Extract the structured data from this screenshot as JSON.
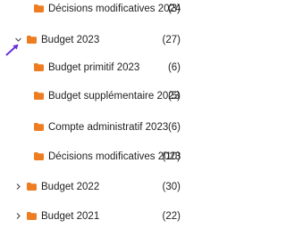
{
  "tree": {
    "items": [
      {
        "label": "Décisions modificatives 2024",
        "count": "(3)",
        "level": 1,
        "expander": "none",
        "folder_icon": "folder-icon"
      },
      {
        "label": "Budget 2023",
        "count": "(27)",
        "level": 0,
        "expander": "expanded",
        "folder_icon": "folder-icon"
      },
      {
        "label": "Budget primitif 2023",
        "count": "(6)",
        "level": 1,
        "expander": "none",
        "folder_icon": "folder-icon"
      },
      {
        "label": "Budget supplémentaire 2023",
        "count": "(5)",
        "level": 1,
        "expander": "none",
        "folder_icon": "folder-icon"
      },
      {
        "label": "Compte administratif 2023",
        "count": "(6)",
        "level": 1,
        "expander": "none",
        "folder_icon": "folder-icon"
      },
      {
        "label": "Décisions modificatives 2023",
        "count": "(10)",
        "level": 1,
        "expander": "none",
        "folder_icon": "folder-icon"
      },
      {
        "label": "Budget 2022",
        "count": "(30)",
        "level": 0,
        "expander": "collapsed",
        "folder_icon": "folder-icon"
      },
      {
        "label": "Budget 2021",
        "count": "(22)",
        "level": 0,
        "expander": "collapsed",
        "folder_icon": "folder-icon"
      }
    ]
  },
  "colors": {
    "folder": "#ee7d22",
    "text": "#1f1f1f",
    "chevron": "#444444",
    "cursor": "#6a2fd6"
  },
  "cursor_icon": "arrow-cursor-icon"
}
